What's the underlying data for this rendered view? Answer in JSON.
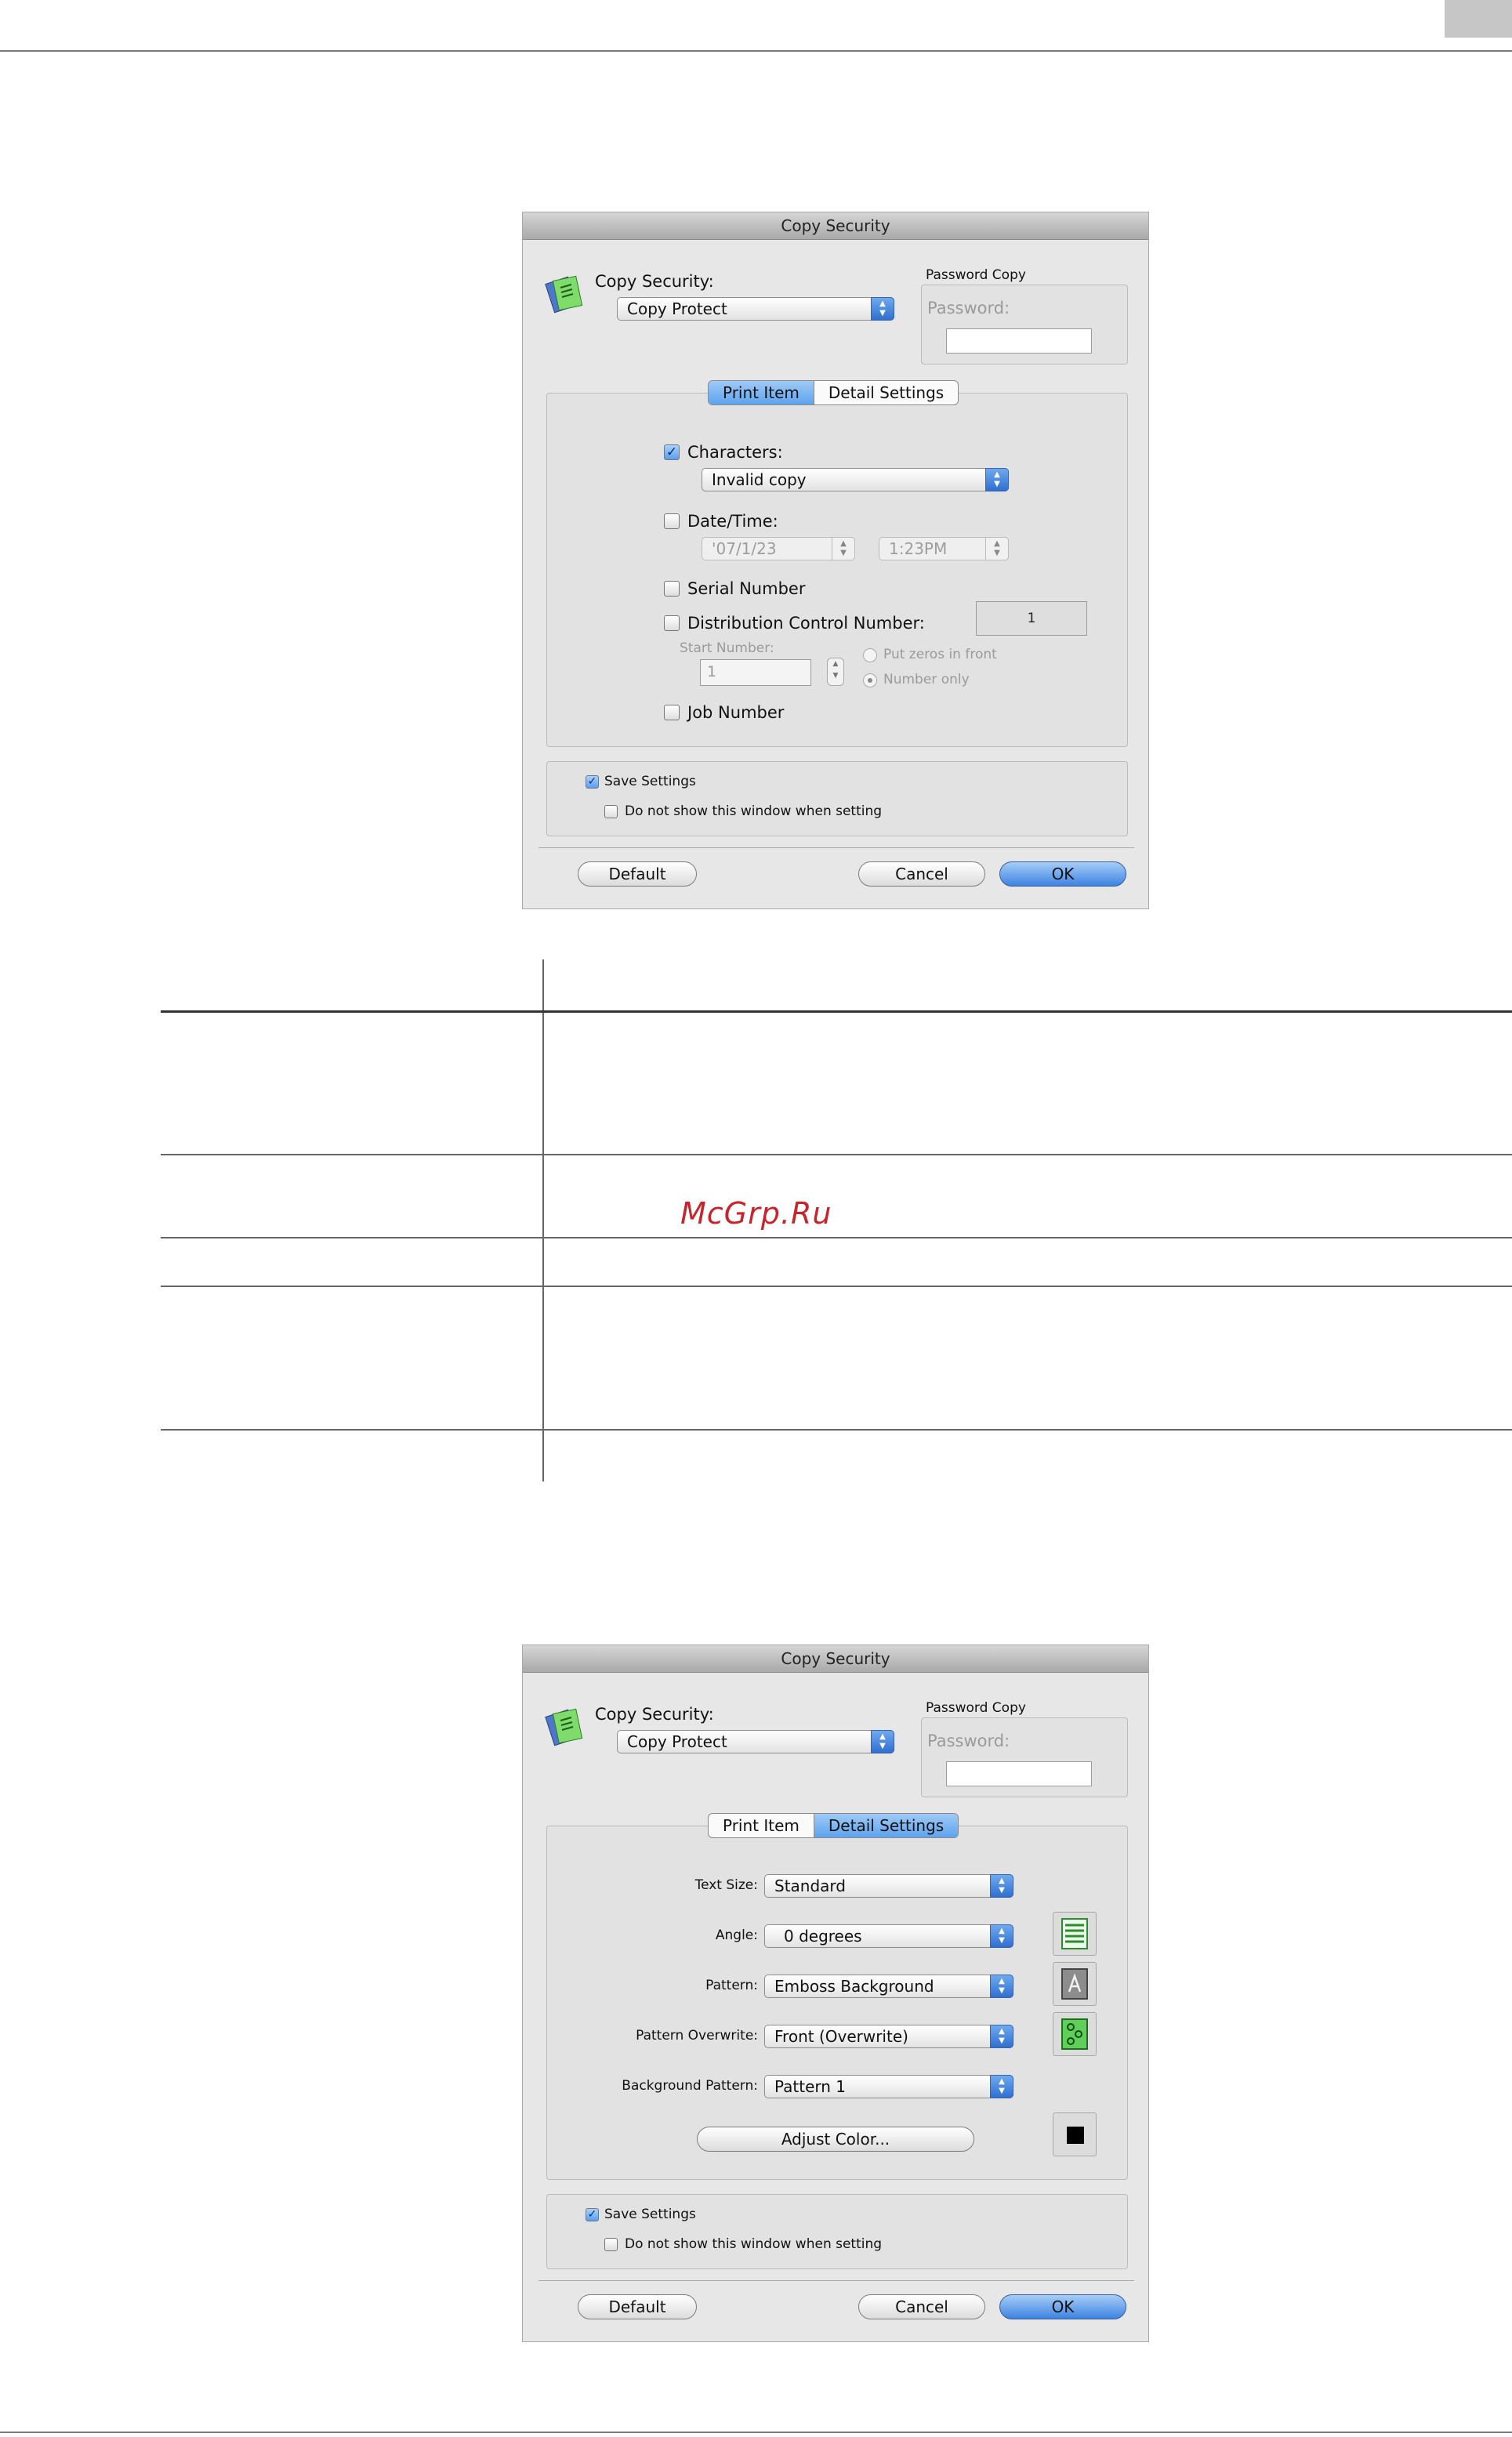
{
  "watermark": "McGrp.Ru",
  "dialogs": [
    {
      "title": "Copy Security",
      "copy_security_label": "Copy Security:",
      "copy_security_value": "Copy Protect",
      "password_copy_group": "Password Copy",
      "password_label": "Password:",
      "tabs": [
        "Print Item",
        "Detail Settings"
      ],
      "active_tab": "Print Item",
      "print_item": {
        "characters_label": "Characters:",
        "characters_checked": true,
        "characters_value": "Invalid copy",
        "datetime_label": "Date/Time:",
        "date_value": "'07/1/23",
        "time_value": "1:23PM",
        "serial_label": "Serial Number",
        "distribution_label": "Distribution Control Number:",
        "distribution_value": "1",
        "start_number_label": "Start Number:",
        "start_number_value": "1",
        "radio_zeros": "Put zeros in front",
        "radio_only": "Number only",
        "job_number_label": "Job Number"
      },
      "save_settings_label": "Save Settings",
      "save_settings_checked": true,
      "do_not_show_label": "Do not show this window when setting",
      "buttons": {
        "default": "Default",
        "cancel": "Cancel",
        "ok": "OK"
      }
    },
    {
      "title": "Copy Security",
      "copy_security_label": "Copy Security:",
      "copy_security_value": "Copy Protect",
      "password_copy_group": "Password Copy",
      "password_label": "Password:",
      "tabs": [
        "Print Item",
        "Detail Settings"
      ],
      "active_tab": "Detail Settings",
      "detail_settings": {
        "text_size_label": "Text Size:",
        "text_size_value": "Standard",
        "angle_label": "Angle:",
        "angle_value": "0 degrees",
        "pattern_label": "Pattern:",
        "pattern_value": "Emboss Background",
        "pattern_overwrite_label": "Pattern Overwrite:",
        "pattern_overwrite_value": "Front (Overwrite)",
        "background_pattern_label": "Background Pattern:",
        "background_pattern_value": "Pattern 1",
        "adjust_color_label": "Adjust Color...",
        "color_swatch": "#000000"
      },
      "save_settings_label": "Save Settings",
      "save_settings_checked": true,
      "do_not_show_label": "Do not show this window when setting",
      "buttons": {
        "default": "Default",
        "cancel": "Cancel",
        "ok": "OK"
      }
    }
  ],
  "colors": {
    "accent": "#3d83e2",
    "dialog_bg": "#e7e7e7",
    "watermark": "#c8242b"
  }
}
